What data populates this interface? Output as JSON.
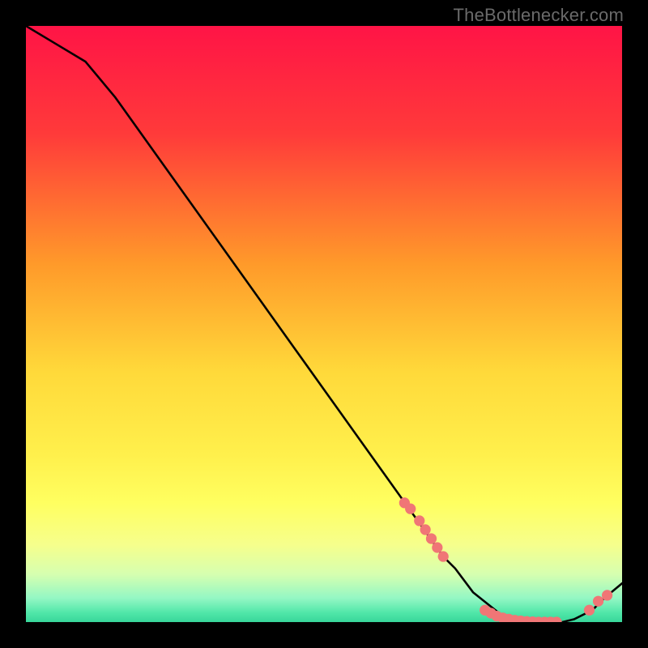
{
  "attribution": "TheBottlenecker.com",
  "chart_data": {
    "type": "line",
    "title": "",
    "xlabel": "",
    "ylabel": "",
    "xlim": [
      0,
      100
    ],
    "ylim": [
      0,
      100
    ],
    "x": [
      0,
      5,
      10,
      15,
      20,
      25,
      30,
      35,
      40,
      45,
      50,
      55,
      60,
      65,
      70,
      72,
      75,
      80,
      85,
      88,
      90,
      92,
      95,
      97,
      100
    ],
    "values": [
      100,
      97,
      94,
      88,
      81,
      74,
      67,
      60,
      53,
      46,
      39,
      32,
      25,
      18,
      11,
      9,
      5,
      1,
      0,
      0,
      0,
      0.5,
      2,
      4,
      6.5
    ],
    "marker_points_x": [
      63.5,
      64.5,
      66,
      67,
      68,
      69,
      70,
      77,
      78,
      79,
      80,
      81,
      82,
      83,
      84,
      85,
      86,
      87,
      88,
      89,
      94.5,
      96,
      97.5
    ],
    "marker_points_y": [
      20,
      19,
      17,
      15.5,
      14,
      12.5,
      11,
      2,
      1.5,
      1,
      0.7,
      0.5,
      0.3,
      0.2,
      0.1,
      0.05,
      0,
      0,
      0,
      0,
      2,
      3.5,
      4.5
    ],
    "gradient_stops": [
      {
        "offset": 0.0,
        "color": "#ff1446"
      },
      {
        "offset": 0.18,
        "color": "#ff3a3a"
      },
      {
        "offset": 0.4,
        "color": "#ff9a2a"
      },
      {
        "offset": 0.58,
        "color": "#ffd93a"
      },
      {
        "offset": 0.72,
        "color": "#fff04c"
      },
      {
        "offset": 0.8,
        "color": "#ffff60"
      },
      {
        "offset": 0.87,
        "color": "#f6ff8c"
      },
      {
        "offset": 0.92,
        "color": "#d6ffb0"
      },
      {
        "offset": 0.96,
        "color": "#93f7c4"
      },
      {
        "offset": 0.985,
        "color": "#4fe6a8"
      },
      {
        "offset": 1.0,
        "color": "#38d69a"
      }
    ],
    "marker_color": "#f07676",
    "line_color": "#000000"
  }
}
